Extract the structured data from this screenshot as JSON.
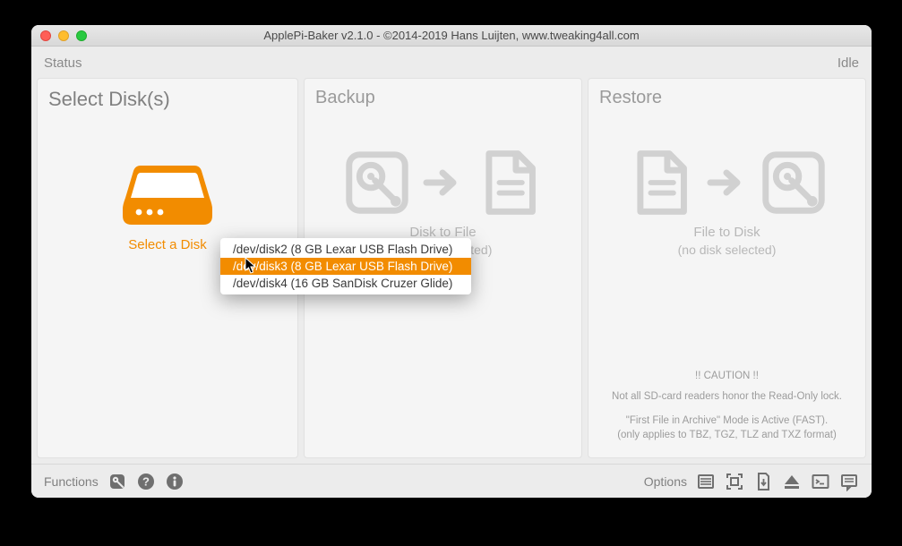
{
  "titlebar": {
    "title": "ApplePi-Baker v2.1.0 - ©2014-2019 Hans Luijten, www.tweaking4all.com"
  },
  "status": {
    "label": "Status",
    "value": "Idle"
  },
  "panels": {
    "select": {
      "title": "Select Disk(s)",
      "disk_label": "Select a Disk"
    },
    "backup": {
      "title": "Backup",
      "label": "Disk to File",
      "sub": "(no disk selected)"
    },
    "restore": {
      "title": "Restore",
      "label": "File to Disk",
      "sub": "(no disk selected)",
      "caution_title": "!! CAUTION !!",
      "caution_line1": "Not all SD-card readers honor the Read-Only lock.",
      "caution_line2": "\"First File in Archive\" Mode is Active (FAST).",
      "caution_line3": "(only applies to TBZ, TGZ, TLZ and TXZ format)"
    }
  },
  "dropdown": {
    "items": [
      "/dev/disk2 (8 GB Lexar USB Flash Drive)",
      "/dev/disk3 (8 GB Lexar USB Flash Drive)",
      "/dev/disk4 (16 GB SanDisk Cruzer Glide)"
    ],
    "selected_index": 1
  },
  "footer": {
    "functions_label": "Functions",
    "options_label": "Options"
  },
  "colors": {
    "accent": "#f28c00",
    "muted": "#b8b8b8"
  }
}
